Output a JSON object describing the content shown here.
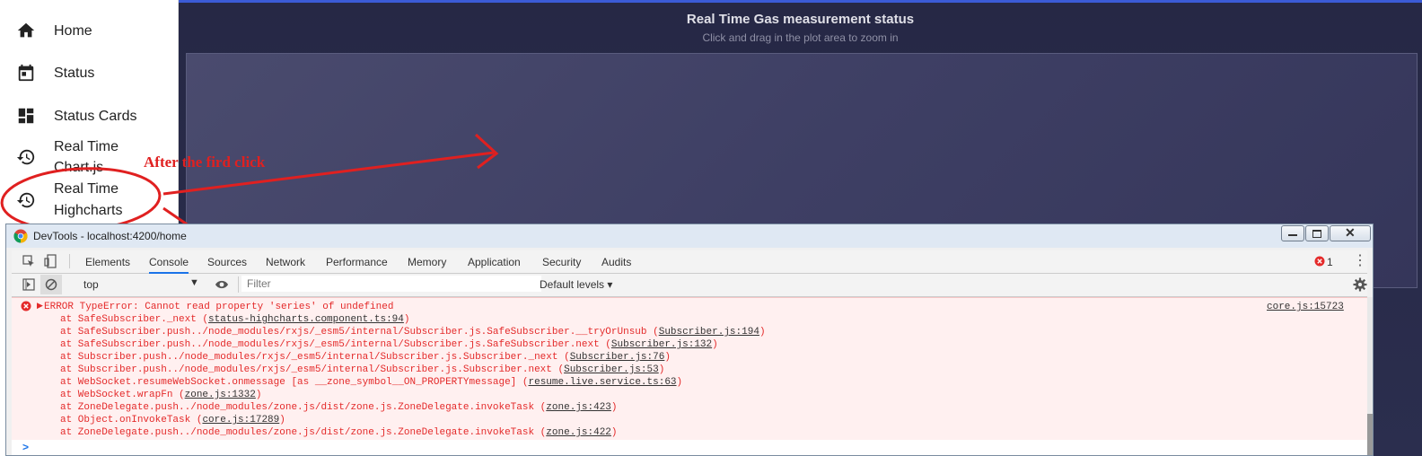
{
  "sidebar": {
    "items": [
      {
        "label": "Home",
        "icon": "home-icon"
      },
      {
        "label": "Status",
        "icon": "calendar-icon"
      },
      {
        "label": "Status Cards",
        "icon": "dashboard-icon"
      },
      {
        "label_line1": "Real Time",
        "label_line2": "Chart.js",
        "icon": "history-icon"
      },
      {
        "label_line1": "Real Time",
        "label_line2": "Highcharts",
        "icon": "history-icon"
      }
    ]
  },
  "chart": {
    "title": "Real Time Gas measurement status",
    "subtitle": "Click and drag in the plot area to zoom in"
  },
  "annotation": {
    "text": "After the fird click",
    "color": "#e02020"
  },
  "devtools": {
    "title": "DevTools - localhost:4200/home",
    "tabs": [
      "Elements",
      "Console",
      "Sources",
      "Network",
      "Performance",
      "Memory",
      "Application",
      "Security",
      "Audits"
    ],
    "active_tab": "Console",
    "error_count": "1",
    "context": "top",
    "filter_placeholder": "Filter",
    "levels": "Default levels",
    "error_source": "core.js:15723",
    "error_headline": "ERROR TypeError: Cannot read property 'series' of undefined",
    "stack": [
      {
        "text": "at SafeSubscriber._next (",
        "link": "status-highcharts.component.ts:94",
        "tail": ")"
      },
      {
        "text": "at SafeSubscriber.push../node_modules/rxjs/_esm5/internal/Subscriber.js.SafeSubscriber.__tryOrUnsub (",
        "link": "Subscriber.js:194",
        "tail": ")"
      },
      {
        "text": "at SafeSubscriber.push../node_modules/rxjs/_esm5/internal/Subscriber.js.SafeSubscriber.next (",
        "link": "Subscriber.js:132",
        "tail": ")"
      },
      {
        "text": "at Subscriber.push../node_modules/rxjs/_esm5/internal/Subscriber.js.Subscriber._next (",
        "link": "Subscriber.js:76",
        "tail": ")"
      },
      {
        "text": "at Subscriber.push../node_modules/rxjs/_esm5/internal/Subscriber.js.Subscriber.next (",
        "link": "Subscriber.js:53",
        "tail": ")"
      },
      {
        "text": "at WebSocket.resumeWebSocket.onmessage [as __zone_symbol__ON_PROPERTYmessage] (",
        "link": "resume.live.service.ts:63",
        "tail": ")"
      },
      {
        "text": "at WebSocket.wrapFn (",
        "link": "zone.js:1332",
        "tail": ")"
      },
      {
        "text": "at ZoneDelegate.push../node_modules/zone.js/dist/zone.js.ZoneDelegate.invokeTask (",
        "link": "zone.js:423",
        "tail": ")"
      },
      {
        "text": "at Object.onInvokeTask (",
        "link": "core.js:17289",
        "tail": ")"
      },
      {
        "text": "at ZoneDelegate.push../node_modules/zone.js/dist/zone.js.ZoneDelegate.invokeTask (",
        "link": "zone.js:422",
        "tail": ")"
      }
    ],
    "prompt": ">"
  }
}
